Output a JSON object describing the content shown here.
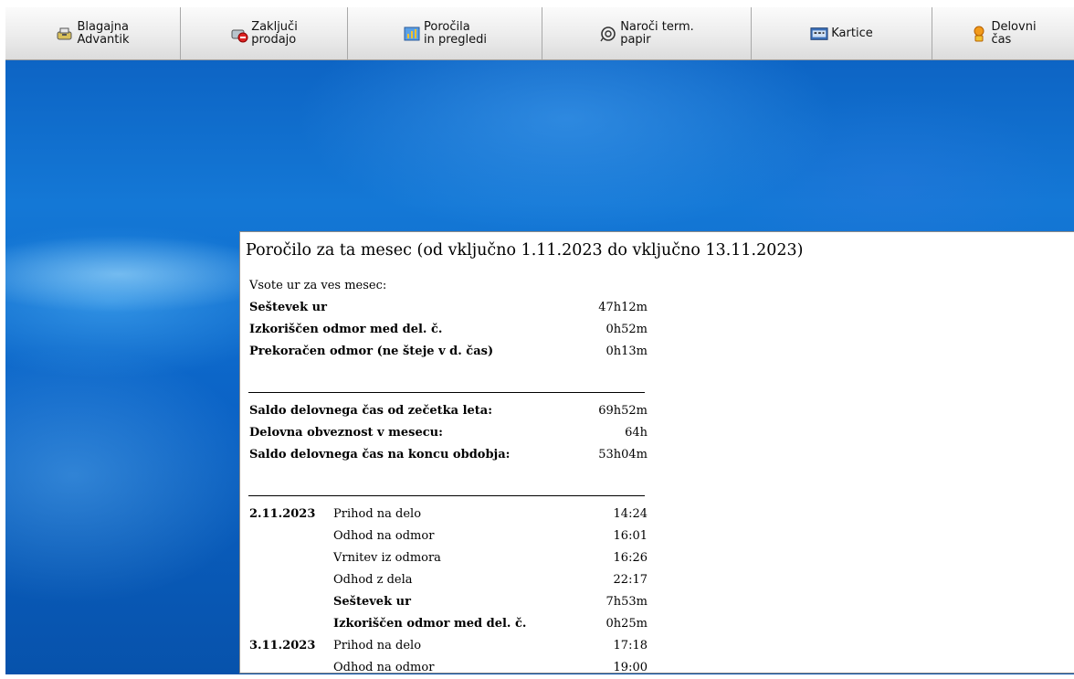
{
  "toolbar": {
    "buttons": [
      {
        "line1": "Blagajna",
        "line2": "Advantik",
        "icon": "cash-register-icon"
      },
      {
        "line1": "Zaključi",
        "line2": "prodajo",
        "icon": "close-sale-icon"
      },
      {
        "line1": "Poročila",
        "line2": "in pregledi",
        "icon": "reports-icon"
      },
      {
        "line1": "Naroči term.",
        "line2": "papir",
        "icon": "paper-roll-icon"
      },
      {
        "line1": "Kartice",
        "line2": "",
        "icon": "cards-icon"
      },
      {
        "line1": "Delovni",
        "line2": "čas",
        "icon": "work-time-icon"
      }
    ]
  },
  "report": {
    "title": "Poročilo za ta mesec (od vključno 1.11.2023 do vključno 13.11.2023)",
    "summary_heading": "Vsote ur za ves mesec:",
    "summary": [
      {
        "label": "Seštevek ur",
        "value": "47h12m"
      },
      {
        "label": "Izkoriščen odmor med del. č.",
        "value": "0h52m"
      },
      {
        "label": "Prekoračen odmor (ne šteje v d. čas)",
        "value": "0h13m"
      }
    ],
    "balance": [
      {
        "label": "Saldo delovnega čas od zečetka leta:",
        "value": "69h52m"
      },
      {
        "label": "Delovna obveznost v mesecu:",
        "value": "64h"
      },
      {
        "label": "Saldo delovnega čas na koncu obdobja:",
        "value": "53h04m"
      }
    ],
    "days": [
      {
        "date": "2.11.2023",
        "entries": [
          {
            "event": "Prihod na delo",
            "time": "14:24"
          },
          {
            "event": "Odhod na odmor",
            "time": "16:01"
          },
          {
            "event": "Vrnitev iz odmora",
            "time": "16:26"
          },
          {
            "event": "Odhod z dela",
            "time": "22:17"
          },
          {
            "event": "Seštevek ur",
            "time": "7h53m"
          },
          {
            "event": "Izkoriščen odmor med del. č.",
            "time": "0h25m"
          }
        ]
      },
      {
        "date": "3.11.2023",
        "entries": [
          {
            "event": "Prihod na delo",
            "time": "17:18"
          },
          {
            "event": "Odhod na odmor",
            "time": "19:00"
          }
        ]
      }
    ]
  },
  "colors": {
    "desktop": "#0a5fc0",
    "toolbar_top": "#fbfbfb",
    "toolbar_bottom": "#dcdcdc",
    "report_bg": "#ffffff"
  }
}
